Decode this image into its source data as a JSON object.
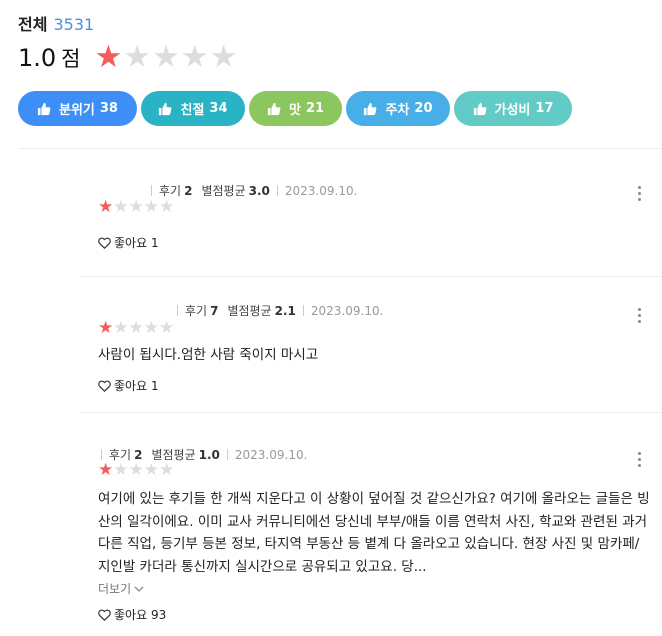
{
  "summary": {
    "label": "전체",
    "count": "3531",
    "score": "1.0",
    "score_unit": "점",
    "rating_stars_filled": 1,
    "rating_stars_total": 5
  },
  "tags": [
    {
      "label": "분위기",
      "count": "38",
      "color": "#3d8ef7"
    },
    {
      "label": "친절",
      "count": "34",
      "color": "#2ab3c4"
    },
    {
      "label": "맛",
      "count": "21",
      "color": "#8cc65e"
    },
    {
      "label": "주차",
      "count": "20",
      "color": "#47aee8"
    },
    {
      "label": "가성비",
      "count": "17",
      "color": "#62cbc5"
    }
  ],
  "reviews": [
    {
      "review_count_label": "후기",
      "review_count": "2",
      "avg_label": "별점평균",
      "avg": "3.0",
      "date": "2023.09.10.",
      "stars_filled": 1,
      "text": "",
      "more_label": "",
      "like_label": "좋아요",
      "likes": "1"
    },
    {
      "review_count_label": "후기",
      "review_count": "7",
      "avg_label": "별점평균",
      "avg": "2.1",
      "date": "2023.09.10.",
      "stars_filled": 1,
      "text": "사람이 됩시다.엄한 사람 죽이지 마시고",
      "more_label": "",
      "like_label": "좋아요",
      "likes": "1"
    },
    {
      "review_count_label": "후기",
      "review_count": "2",
      "avg_label": "별점평균",
      "avg": "1.0",
      "date": "2023.09.10.",
      "stars_filled": 1,
      "text": "여기에 있는 후기들 한 개씩 지운다고 이 상황이 덮어질 것 같으신가요? 여기에 올라오는 글들은 빙산의 일각이에요. 이미 교사 커뮤니티에선 당신네 부부/애들 이름 연락처 사진, 학교와 관련된 과거 다른 직업, 등기부 등본 정보, 타지역 부동산 등 볕계 다 올라오고 있습니다. 현장 사진 및 맘카페/지인발 카더라 통신까지 실시간으로 공유되고 있고요. 당...",
      "more_label": "더보기",
      "like_label": "좋아요",
      "likes": "93"
    }
  ],
  "colors": {
    "star_on": "#f25c5c",
    "star_off": "#dddddd",
    "count_blue": "#4a90e2"
  }
}
